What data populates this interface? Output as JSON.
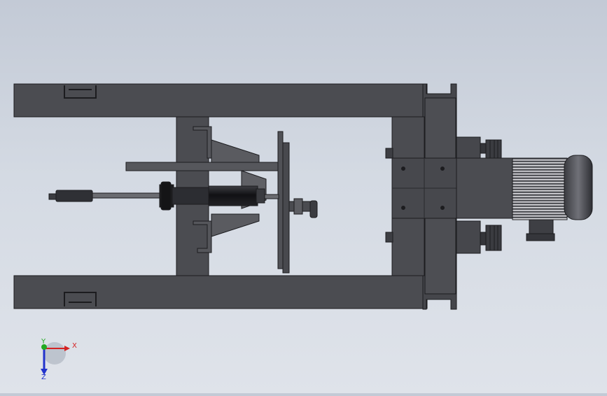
{
  "viewport": {
    "background_top": "#c3cad6",
    "background_bottom": "#dfe3ea",
    "part_color": "#4b4c51",
    "edge_color": "#1c1c1f"
  },
  "triad": {
    "x_label": "X",
    "y_label": "Y",
    "z_label": "Z",
    "x_color": "#d42222",
    "y_color": "#22aa22",
    "z_color": "#2233cc"
  }
}
